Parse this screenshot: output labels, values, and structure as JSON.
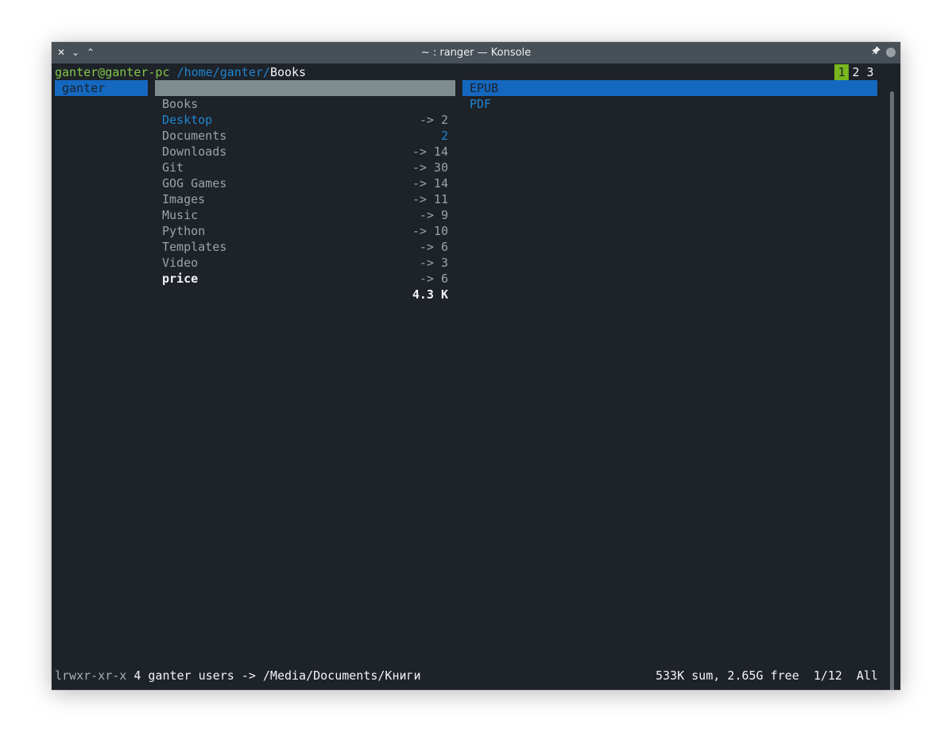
{
  "window": {
    "title": "~ : ranger — Konsole",
    "buttons": {
      "close": "✕",
      "minimize": "⌄",
      "maximize": "⌃",
      "pin": "📌"
    }
  },
  "header": {
    "user_host": "ganter@ganter-pc",
    "path": "/home/ganter/",
    "current": "Books",
    "tabs": [
      "1",
      "2",
      "3"
    ],
    "active_tab": "1"
  },
  "parent_column": {
    "items": [
      {
        "name": "ganter",
        "selected": true
      }
    ]
  },
  "current_column": {
    "items": [
      {
        "name": "Books",
        "info": "-> 2",
        "kind": "link",
        "selected": true
      },
      {
        "name": "Desktop",
        "info": "2",
        "kind": "dir"
      },
      {
        "name": "Documents",
        "info": "-> 14",
        "kind": "link"
      },
      {
        "name": "Downloads",
        "info": "-> 30",
        "kind": "link"
      },
      {
        "name": "Git",
        "info": "-> 14",
        "kind": "link"
      },
      {
        "name": "GOG Games",
        "info": "-> 11",
        "kind": "link"
      },
      {
        "name": "Images",
        "info": "-> 9",
        "kind": "link"
      },
      {
        "name": "Music",
        "info": "-> 10",
        "kind": "link"
      },
      {
        "name": "Python",
        "info": "-> 6",
        "kind": "link"
      },
      {
        "name": "Templates",
        "info": "-> 3",
        "kind": "link"
      },
      {
        "name": "Video",
        "info": "-> 6",
        "kind": "link"
      },
      {
        "name": "price",
        "info": "4.3 K",
        "kind": "file"
      }
    ]
  },
  "preview_column": {
    "items": [
      {
        "name": "EPUB",
        "selected": true
      },
      {
        "name": "PDF"
      }
    ]
  },
  "status": {
    "permissions": "lrwxr-xr-x",
    "details": "4 ganter users -> /Media/Documents/Книги",
    "sum": "533K sum, 2.65G free",
    "position": "1/12",
    "scroll": "All"
  },
  "colors": {
    "background": "#1e2229",
    "accent_blue": "#1468c0",
    "prompt_green": "#83c64a",
    "tab_active": "#78b61e"
  }
}
